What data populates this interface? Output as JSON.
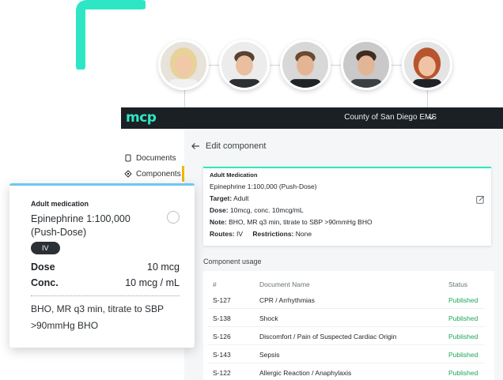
{
  "app": {
    "brand": "mcp",
    "organization": "County of San Diego EMS"
  },
  "avatars": [
    {
      "icon": "person-avatar-blonde-woman"
    },
    {
      "icon": "person-avatar-man"
    },
    {
      "icon": "person-avatar-man-smiling"
    },
    {
      "icon": "person-avatar-young-man"
    },
    {
      "icon": "person-avatar-redhead-woman"
    }
  ],
  "sidebar": {
    "items": [
      {
        "label": "Documents",
        "icon": "document-icon"
      },
      {
        "label": "Components",
        "icon": "component-icon",
        "active": true
      }
    ]
  },
  "header": {
    "title": "Edit component"
  },
  "detail": {
    "category": "Adult Medication",
    "name": "Epinephrine 1:100,000 (Push-Dose)",
    "target_label": "Target:",
    "target_value": "Adult",
    "dose_label": "Dose:",
    "dose_value": "10mcg, conc. 10mcg/mL",
    "note_label": "Note:",
    "note_value": "BHO, MR q3 min, titrate to SBP >90mmHg BHO",
    "routes_label": "Routes:",
    "routes_value": "IV",
    "restrictions_label": "Restrictions:",
    "restrictions_value": "None"
  },
  "usage": {
    "title": "Component usage",
    "columns": [
      "#",
      "Document Name",
      "Status"
    ],
    "rows": [
      {
        "id": "S-127",
        "name": "CPR / Arrhythmias",
        "status": "Published"
      },
      {
        "id": "S-138",
        "name": "Shock",
        "status": "Published"
      },
      {
        "id": "S-126",
        "name": "Discomfort / Pain of Suspected Cardiac Origin",
        "status": "Published"
      },
      {
        "id": "S-143",
        "name": "Sepsis",
        "status": "Published"
      },
      {
        "id": "S-122",
        "name": "Allergic Reaction / Anaphylaxis",
        "status": "Published"
      }
    ]
  },
  "med_card": {
    "category": "Adult medication",
    "name": "Epinephrine 1:100,000 (Push-Dose)",
    "route": "IV",
    "dose_label": "Dose",
    "dose_value": "10 mcg",
    "conc_label": "Conc.",
    "conc_value": "10 mcg / mL",
    "note": "BHO, MR q3 min, titrate to SBP >90mmHg BHO"
  },
  "colors": {
    "accent_teal": "#2ee6c4",
    "topbar": "#1b2024",
    "status_published": "#1ea55a",
    "active_nav": "#f2b705",
    "card_accent": "#6ec6f2"
  }
}
